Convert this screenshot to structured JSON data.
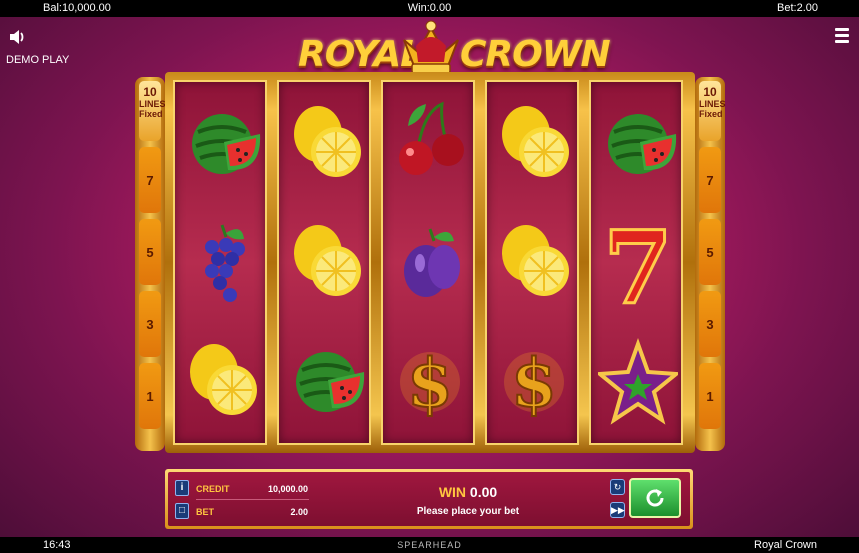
{
  "topbar": {
    "balance": "Bal:10,000.00",
    "win": "Win:0.00",
    "bet": "Bet:2.00"
  },
  "header": {
    "demo_label": "DEMO PLAY",
    "logo_word1": "ROYAL",
    "logo_word2": "CROWN"
  },
  "icons": {
    "sound": "speaker-icon",
    "menu": "hamburger-menu-icon"
  },
  "lines": {
    "left": {
      "count": "10",
      "word": "LINES",
      "mode": "Fixed",
      "markers": [
        "",
        "7",
        "5",
        "3",
        "1"
      ]
    },
    "right": {
      "count": "10",
      "word": "LINES",
      "mode": "Fixed",
      "markers": [
        "",
        "7",
        "5",
        "3",
        "1"
      ]
    }
  },
  "reels": [
    [
      "watermelon",
      "grapes",
      "lemon"
    ],
    [
      "lemon",
      "lemon",
      "watermelon"
    ],
    [
      "cherries",
      "plum",
      "dollar"
    ],
    [
      "lemon",
      "lemon",
      "dollar"
    ],
    [
      "watermelon",
      "seven",
      "star"
    ]
  ],
  "panel": {
    "credit_label": "CREDIT",
    "credit_value": "10,000.00",
    "bet_label": "BET",
    "bet_value": "2.00",
    "win_label": "WIN",
    "win_value": "0.00",
    "message": "Please place your bet"
  },
  "bottombar": {
    "clock": "16:43",
    "provider": "SPEARHEAD",
    "game_name": "Royal Crown"
  },
  "colors": {
    "gold": "#f7c24a",
    "accent_yellow": "#ffc640",
    "spin_green": "#2ea63c",
    "background": "#b51c63"
  }
}
